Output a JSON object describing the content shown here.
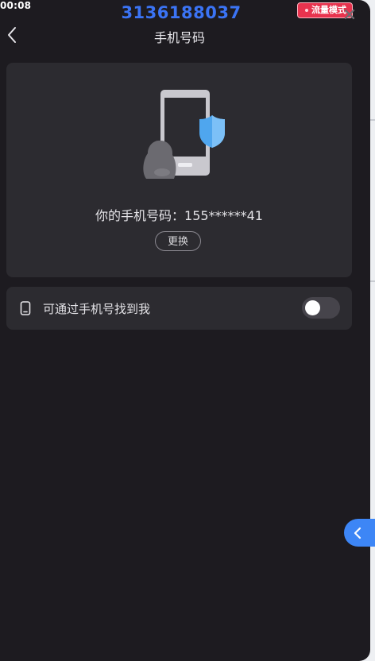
{
  "status_bar": {
    "time": "00:08"
  },
  "overlay": {
    "account_id": "3136188037",
    "mode_badge": "流量模式",
    "accent_color": "#3b74f5",
    "badge_color": "#e8334e"
  },
  "header": {
    "title": "手机号码",
    "back_icon": "chevron-left-icon",
    "close_icon": "close-icon"
  },
  "phone_card": {
    "illustration": "phone-shield-icon",
    "number_label": "你的手机号码：155******41",
    "change_button": "更换"
  },
  "find_me_setting": {
    "icon": "mobile-phone-icon",
    "label": "可通过手机号找到我",
    "enabled": false
  },
  "floating_tab": {
    "icon": "chevron-left-icon",
    "color": "#3d86f6"
  }
}
